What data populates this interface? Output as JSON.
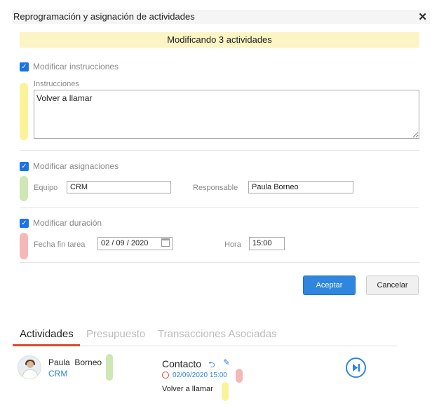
{
  "dialog": {
    "title": "Reprogramación y asignación de actividades",
    "close_glyph": "✕",
    "banner": "Modificando 3 actividades"
  },
  "instructions_section": {
    "checkbox_label": "Modificar instrucciones",
    "checked": true,
    "field_label": "Instrucciones",
    "value": "Volver a llamar"
  },
  "assignments_section": {
    "checkbox_label": "Modificar asignaciones",
    "checked": true,
    "team_label": "Equipo",
    "team_value": "CRM",
    "owner_label": "Responsable",
    "owner_value": "Paula Borneo"
  },
  "duration_section": {
    "checkbox_label": "Modificar duración",
    "checked": true,
    "end_date_label": "Fecha fin tarea",
    "date_day": "02",
    "date_month": "09",
    "date_year": "2020",
    "time_label": "Hora",
    "time_value": "15:00"
  },
  "buttons": {
    "accept": "Aceptar",
    "cancel": "Cancelar"
  },
  "tabs": [
    {
      "label": "Actividades",
      "active": true
    },
    {
      "label": "Presupuesto",
      "active": false
    },
    {
      "label": "Transacciones Asociadas",
      "active": false
    }
  ],
  "activity": {
    "person_first": "Paula",
    "person_last": "Borneo",
    "team": "CRM",
    "type": "Contacto",
    "date": "02/09/2020 15:00",
    "description": "Volver a llamar"
  },
  "colors": {
    "accent": "#2e86de",
    "banner_bg": "#fcf4c4",
    "tab_underline": "#e04a2f",
    "squiggle_yellow": "#fbf39a",
    "squiggle_green": "#cde8b5",
    "squiggle_red": "#f5b8b8"
  },
  "icons": {
    "checkbox": "checkmark-icon",
    "calendar": "calendar-icon",
    "reply": "reply-icon",
    "edit": "edit-icon",
    "clock": "clock-icon",
    "play": "skip-next-icon"
  }
}
